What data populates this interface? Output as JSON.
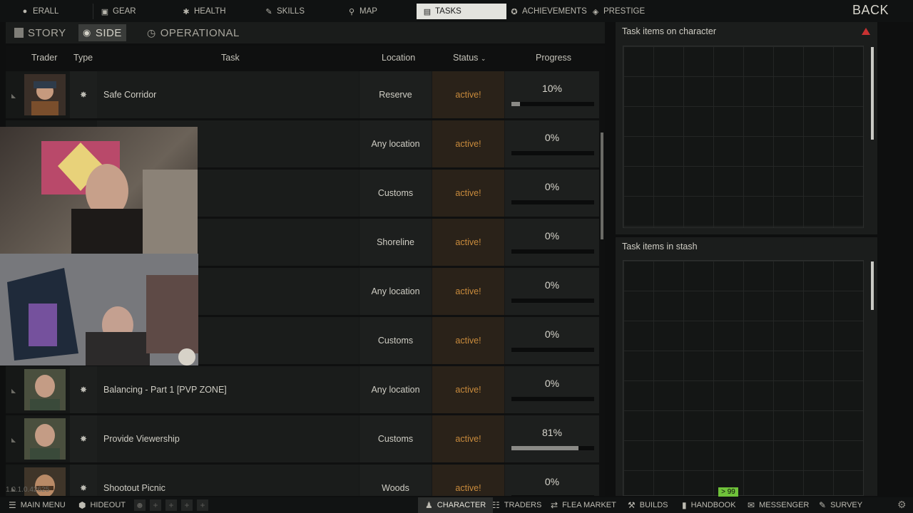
{
  "nav": {
    "tabs": [
      {
        "label": "ERALL",
        "icon": "avatar-icon"
      },
      {
        "label": "GEAR",
        "icon": "shirt-icon"
      },
      {
        "label": "HEALTH",
        "icon": "health-icon"
      },
      {
        "label": "SKILLS",
        "icon": "skills-icon"
      },
      {
        "label": "MAP",
        "icon": "map-pin-icon"
      },
      {
        "label": "TASKS",
        "icon": "tasks-icon"
      },
      {
        "label": "ACHIEVEMENTS",
        "icon": "star-icon"
      },
      {
        "label": "PRESTIGE",
        "icon": "prestige-icon"
      }
    ],
    "active_tab": "TASKS",
    "back_label": "BACK"
  },
  "subtabs": {
    "story": "STORY",
    "side": "SIDE",
    "operational": "OPERATIONAL",
    "active": "SIDE"
  },
  "table": {
    "headers": {
      "trader": "Trader",
      "type": "Type",
      "task": "Task",
      "location": "Location",
      "status": "Status",
      "progress": "Progress"
    },
    "rows": [
      {
        "task": "Safe Corridor",
        "location": "Reserve",
        "status": "active!",
        "progress": "10%",
        "progress_value": 0.1
      },
      {
        "task": "",
        "location": "Any location",
        "status": "active!",
        "progress": "0%",
        "progress_value": 0.0
      },
      {
        "task": "",
        "location": "Customs",
        "status": "active!",
        "progress": "0%",
        "progress_value": 0.0
      },
      {
        "task": "",
        "location": "Shoreline",
        "status": "active!",
        "progress": "0%",
        "progress_value": 0.0
      },
      {
        "task": "",
        "location": "Any location",
        "status": "active!",
        "progress": "0%",
        "progress_value": 0.0
      },
      {
        "task": "",
        "location": "Customs",
        "status": "active!",
        "progress": "0%",
        "progress_value": 0.0
      },
      {
        "task": "Balancing - Part 1 [PVP ZONE]",
        "location": "Any location",
        "status": "active!",
        "progress": "0%",
        "progress_value": 0.0
      },
      {
        "task": "Provide Viewership",
        "location": "Customs",
        "status": "active!",
        "progress": "81%",
        "progress_value": 0.81
      },
      {
        "task": "Shootout Picnic",
        "location": "Woods",
        "status": "active!",
        "progress": "0%",
        "progress_value": 0.0
      }
    ]
  },
  "panels": {
    "on_character": "Task items on character",
    "in_stash": "Task items in stash"
  },
  "bottom": {
    "main_menu": "MAIN MENU",
    "hideout": "HIDEOUT",
    "character": "CHARACTER",
    "traders": "TRADERS",
    "flea_market": "FLEA MARKET",
    "builds": "BUILDS",
    "handbook": "HANDBOOK",
    "messenger": "MESSENGER",
    "survey": "SURVEY",
    "badge": "> 99"
  },
  "version": "1.0.1.0.42625",
  "colors": {
    "status_active": "#c98b3c",
    "badge_green": "#6fc23a",
    "warning_red": "#c83232"
  }
}
